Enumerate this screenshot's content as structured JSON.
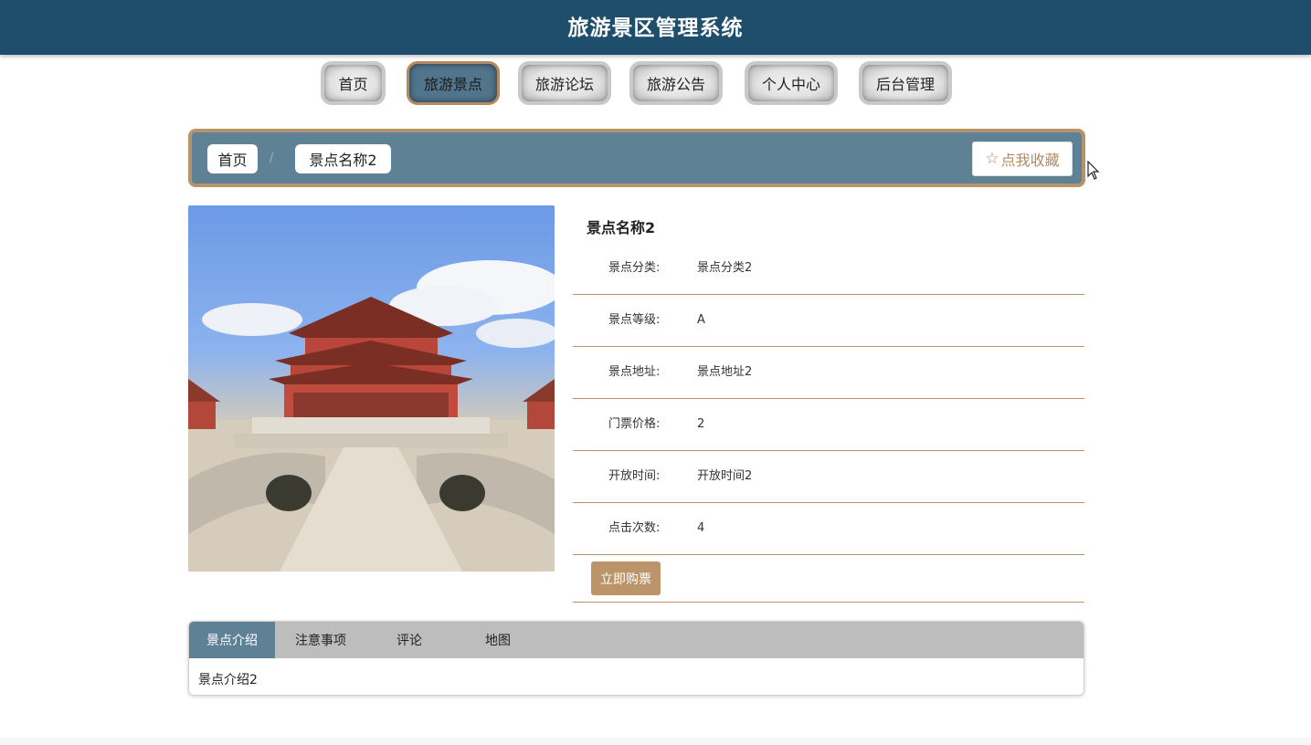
{
  "header": {
    "title": "旅游景区管理系统"
  },
  "nav": {
    "items": [
      {
        "label": "首页"
      },
      {
        "label": "旅游景点"
      },
      {
        "label": "旅游论坛"
      },
      {
        "label": "旅游公告"
      },
      {
        "label": "个人中心"
      },
      {
        "label": "后台管理"
      }
    ],
    "active": "旅游景点"
  },
  "breadcrumb": {
    "items": [
      {
        "label": "首页"
      },
      {
        "label": "景点名称2"
      }
    ],
    "separator": "/",
    "favorite_label": "点我收藏",
    "favorite_icon": "star-outline-icon"
  },
  "detail": {
    "title": "景点名称2",
    "fields": [
      {
        "label": "景点分类:",
        "value": "景点分类2"
      },
      {
        "label": "景点等级:",
        "value": "A"
      },
      {
        "label": "景点地址:",
        "value": "景点地址2"
      },
      {
        "label": "门票价格:",
        "value": "2"
      },
      {
        "label": "开放时间:",
        "value": "开放时间2"
      },
      {
        "label": "点击次数:",
        "value": "4"
      }
    ],
    "buy_label": "立即购票"
  },
  "tabs": {
    "items": [
      {
        "label": "景点介绍"
      },
      {
        "label": "注意事项"
      },
      {
        "label": "评论"
      },
      {
        "label": "地图"
      }
    ],
    "active": "景点介绍",
    "content": "景点介绍2"
  },
  "colors": {
    "header": "#1e4e6c",
    "accent_blue": "#5f8196",
    "accent_gold": "#b79369",
    "button_gold": "#bb9469"
  }
}
